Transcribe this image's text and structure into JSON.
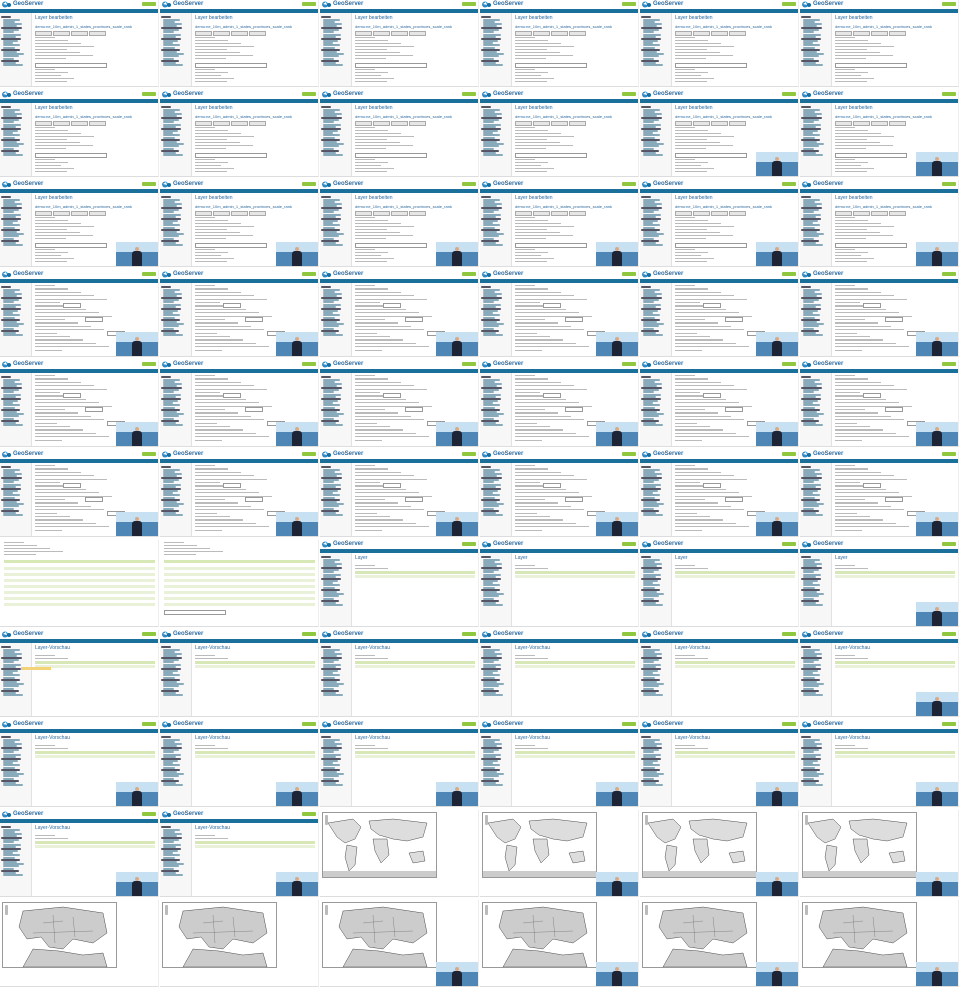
{
  "app": {
    "brand": "GeoServer",
    "logout_label": "",
    "logged_in_text": "",
    "nav_bar_text": ""
  },
  "pages": {
    "layer_edit": {
      "title": "Layer bearbeiten",
      "subtitle": "",
      "layer_name": "demo:ne_10m_admin_1_states_provinces_scale_rank"
    },
    "layer_list": {
      "title": "Layer",
      "subtitle": ""
    },
    "layer_preview": {
      "title": "Layer-Vorschau",
      "subtitle": ""
    },
    "map": {
      "caption": ""
    }
  },
  "colors": {
    "header_bar": "#1b6f9b",
    "brand": "#2b6aa0",
    "logout_button": "#8fc73e",
    "table_header": "#d7e8b6"
  },
  "grid": {
    "columns": 6,
    "rows": 11,
    "tiles": [
      "layer_edit",
      "layer_edit",
      "layer_edit",
      "layer_edit",
      "layer_edit",
      "layer_edit",
      "layer_edit",
      "layer_edit",
      "layer_edit",
      "layer_edit",
      "layer_edit_v",
      "layer_edit_v",
      "layer_edit_v",
      "layer_edit_v",
      "layer_edit_v",
      "layer_edit_v",
      "layer_edit_v",
      "layer_edit_v",
      "layer_form_v",
      "layer_form_v",
      "layer_form_v",
      "layer_form_v",
      "layer_form_v",
      "layer_form_v",
      "layer_form_v",
      "layer_form_v",
      "layer_form_v",
      "layer_form_v",
      "layer_form_v",
      "layer_form_v",
      "layer_form_v",
      "layer_form_v",
      "layer_form_v",
      "layer_form_v",
      "layer_form_v",
      "layer_form_v",
      "layer_table",
      "layer_form_plain",
      "layer_list",
      "layer_list",
      "layer_list",
      "layer_list_v",
      "layer_list_hl",
      "layer_preview",
      "layer_preview",
      "layer_preview",
      "layer_preview",
      "layer_preview_v",
      "layer_preview_v",
      "layer_preview_v",
      "layer_preview_v",
      "layer_preview_v",
      "layer_preview_v",
      "layer_preview_v",
      "layer_preview_v",
      "layer_preview_v",
      "map_world",
      "map_world_v",
      "map_world_v",
      "map_world_v",
      "map_europe",
      "map_europe",
      "map_europe_v",
      "map_europe_v",
      "map_europe_v",
      "map_europe_v"
    ]
  }
}
